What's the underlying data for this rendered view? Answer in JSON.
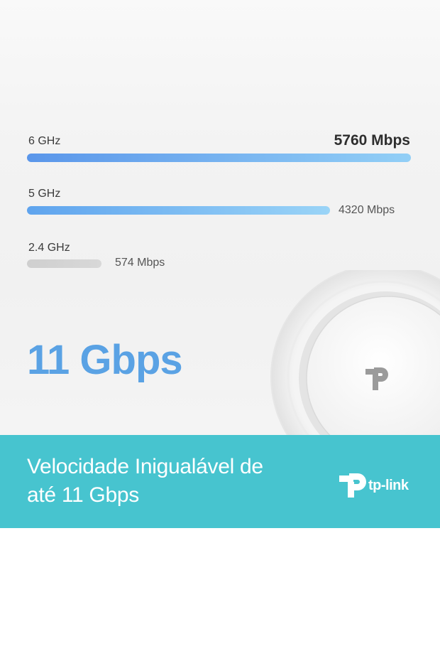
{
  "bands": [
    {
      "label": "6 GHz",
      "value": "5760 Mbps",
      "fraction": 1.0,
      "color_start": "#5a96ea",
      "color_end": "#92cff6"
    },
    {
      "label": "5 GHz",
      "value": "4320 Mbps",
      "fraction": 0.75,
      "color_start": "#5fa4ee",
      "color_end": "#9ad4f7"
    },
    {
      "label": "2.4 GHz",
      "value": "574 Mbps",
      "fraction": 0.1,
      "color_start": "#cfcfcf",
      "color_end": "#d8d8d8"
    }
  ],
  "total_speed": "11 Gbps",
  "banner": {
    "line1": "Velocidade Inigualável de",
    "line2": "até 11 Gbps"
  },
  "brand": {
    "name": "tp-link",
    "icon": "tp-link-logo-icon"
  },
  "colors": {
    "accent_text": "#5aa2e4",
    "banner_bg": "#47c4cf"
  }
}
